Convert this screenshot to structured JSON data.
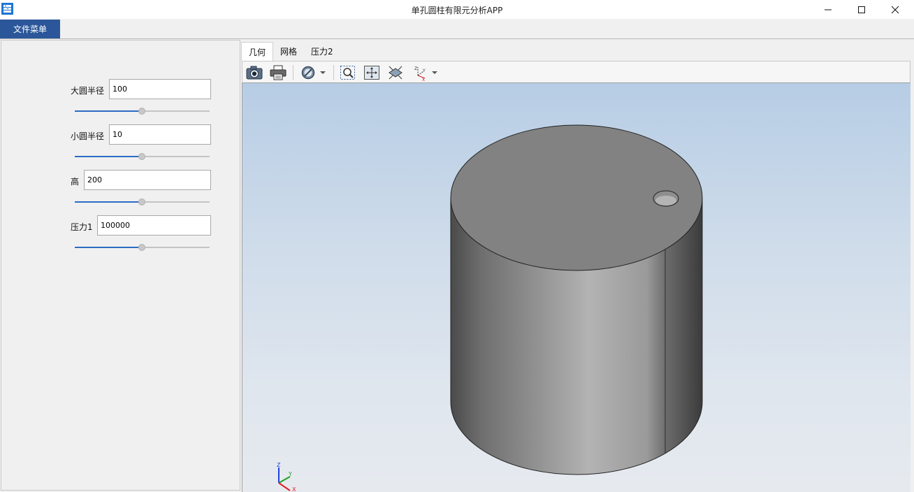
{
  "window": {
    "title": "单孔圆柱有限元分析APP",
    "icon": "app-icon",
    "controls": [
      "minimize-icon",
      "maximize-icon",
      "close-icon"
    ]
  },
  "menu": {
    "file_label": "文件菜单"
  },
  "params": [
    {
      "label": "大圆半径",
      "value": "100",
      "slider_fraction": 0.5
    },
    {
      "label": "小圆半径",
      "value": "10",
      "slider_fraction": 0.5
    },
    {
      "label": "高",
      "value": "200",
      "slider_fraction": 0.5
    },
    {
      "label": "压力1",
      "value": "100000",
      "slider_fraction": 0.5
    }
  ],
  "tabs": [
    {
      "label": "几何",
      "active": true
    },
    {
      "label": "网格",
      "active": false
    },
    {
      "label": "压力2",
      "active": false
    }
  ],
  "toolbar": {
    "icons": [
      "camera-icon",
      "print-icon",
      "hide-icon",
      "dropdown-arrow-icon",
      "zoom-box-icon",
      "fit-all-icon",
      "view-orientation-icon",
      "axis-triad-icon",
      "dropdown-arrow-icon"
    ]
  },
  "viewport": {
    "model": "cylinder-with-hole",
    "axis_labels": {
      "z": "Z",
      "y": "Y",
      "x": "X"
    },
    "colors": {
      "bg_top": "#b7cde5",
      "bg_bottom": "#e6eaef",
      "top_face": "#828282",
      "side_dark": "#3a3a3a",
      "side_light": "#b0b0b0",
      "axis_x": "#e02020",
      "axis_y": "#20a020",
      "axis_z": "#2040e0"
    }
  },
  "colors": {
    "accent": "#2b579a",
    "slider_fill": "#2b6cc4"
  }
}
